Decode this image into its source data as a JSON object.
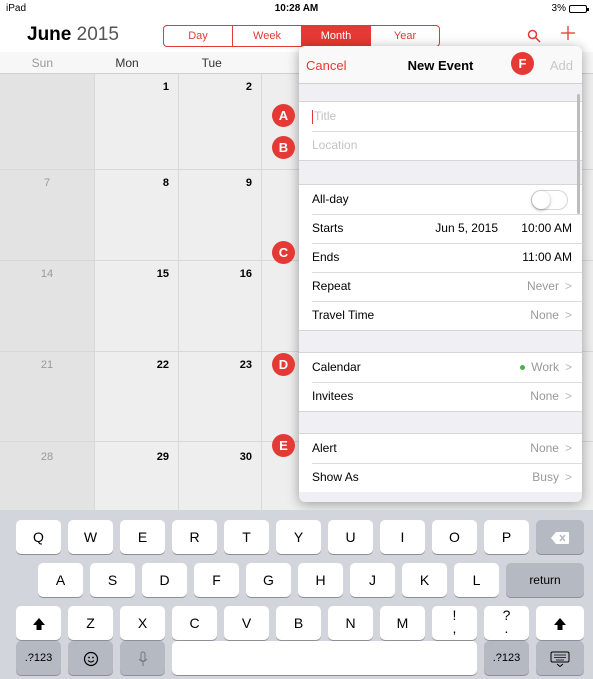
{
  "status_bar": {
    "device": "iPad",
    "time": "10:28 AM",
    "battery": "3%"
  },
  "calendar": {
    "month": "June",
    "year": "2015",
    "views": [
      "Day",
      "Week",
      "Month",
      "Year"
    ],
    "active_view": "Month",
    "weekdays": [
      "Sun",
      "Mon",
      "Tue"
    ],
    "weeks": [
      [
        "",
        "1",
        "2"
      ],
      [
        "7",
        "8",
        "9"
      ],
      [
        "14",
        "15",
        "16"
      ],
      [
        "21",
        "22",
        "23"
      ],
      [
        "28",
        "29",
        "30"
      ]
    ]
  },
  "new_event": {
    "cancel": "Cancel",
    "title": "New Event",
    "add": "Add",
    "title_placeholder": "Title",
    "location_placeholder": "Location",
    "all_day": "All-day",
    "starts": "Starts",
    "starts_date": "Jun 5, 2015",
    "starts_time": "10:00 AM",
    "ends": "Ends",
    "ends_time": "11:00 AM",
    "repeat": "Repeat",
    "repeat_value": "Never",
    "travel_time": "Travel Time",
    "travel_value": "None",
    "calendar": "Calendar",
    "calendar_value": "Work",
    "calendar_color": "#4caf50",
    "invitees": "Invitees",
    "invitees_value": "None",
    "alert": "Alert",
    "alert_value": "None",
    "show_as": "Show As",
    "show_as_value": "Busy"
  },
  "markers": [
    "A",
    "B",
    "C",
    "D",
    "E",
    "F"
  ],
  "keyboard": {
    "row1": [
      "Q",
      "W",
      "E",
      "R",
      "T",
      "Y",
      "U",
      "I",
      "O",
      "P"
    ],
    "row2": [
      "A",
      "S",
      "D",
      "F",
      "G",
      "H",
      "J",
      "K",
      "L"
    ],
    "row3": [
      "Z",
      "X",
      "C",
      "V",
      "B",
      "N",
      "M",
      "!\n,",
      "?\n."
    ],
    "return": "return",
    "numbers": ".?123"
  },
  "accent_color": "#e53935"
}
